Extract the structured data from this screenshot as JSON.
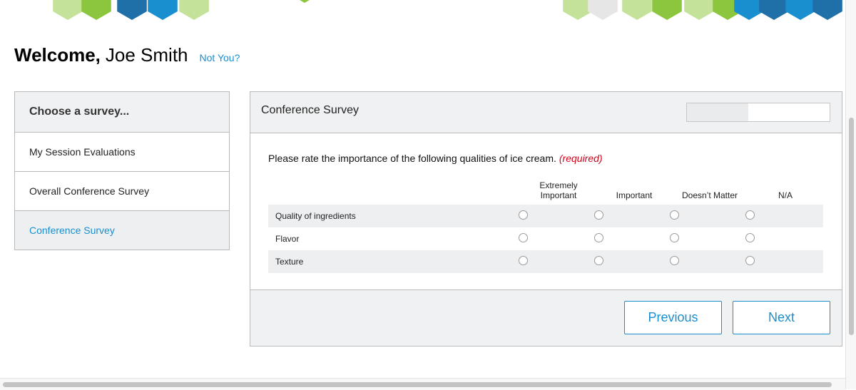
{
  "colors": {
    "accent": "#1a8fcf",
    "required": "#d0021b",
    "hex_green": "#8cc63f",
    "hex_light_green": "#c5e29a",
    "hex_blue": "#1a8fcf",
    "hex_dark_blue": "#1f6fa8",
    "hex_gray": "#e6e6e6"
  },
  "header": {
    "welcome": "Welcome,",
    "user_name": "Joe Smith",
    "not_you": "Not You?"
  },
  "sidebar": {
    "title": "Choose a survey...",
    "items": [
      {
        "label": "My Session Evaluations",
        "active": false
      },
      {
        "label": "Overall Conference Survey",
        "active": false
      },
      {
        "label": "Conference Survey",
        "active": true
      }
    ]
  },
  "survey": {
    "title": "Conference Survey",
    "progress": 0.43,
    "question": "Please rate the importance of the following qualities of ice cream.",
    "required_label": "(required)",
    "columns": [
      "Extremely Important",
      "Important",
      "Doesn't Matter",
      "N/A"
    ],
    "column_lines": [
      [
        "Extremely",
        "Important"
      ],
      [
        "Important"
      ],
      [
        "Doesn’t Matter"
      ],
      [
        "N/A"
      ]
    ],
    "rows": [
      "Quality of ingredients",
      "Flavor",
      "Texture"
    ],
    "previous_label": "Previous",
    "next_label": "Next"
  }
}
